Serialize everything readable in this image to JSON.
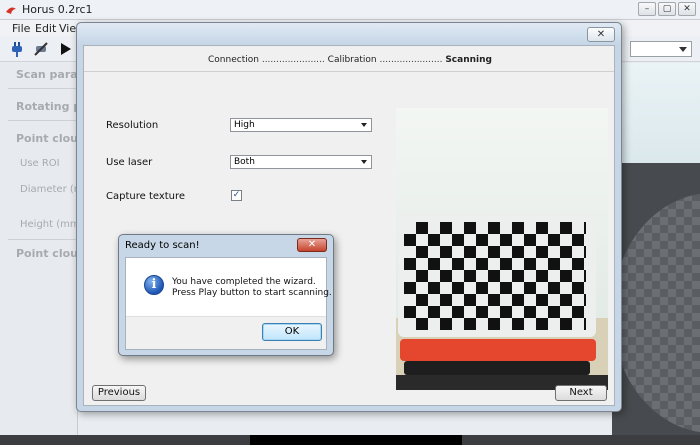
{
  "app": {
    "title": "Horus 0.2rc1",
    "menu": [
      "File",
      "Edit",
      "View"
    ],
    "window_controls": {
      "minimize": "–",
      "maximize": "▢",
      "close": "✕"
    },
    "toolbar": {
      "combo_value": ""
    }
  },
  "left_panel": {
    "headers": [
      "Scan parameters",
      "Rotating platform",
      "Point cloud ROI",
      "Point cloud color"
    ],
    "labels": [
      "Use ROI",
      "Diameter (mm)",
      "Height (mm)"
    ]
  },
  "wizard": {
    "close_label": "✕",
    "steps": [
      {
        "label": "Connection",
        "active": false
      },
      {
        "label": "Calibration",
        "active": false
      },
      {
        "label": "Scanning",
        "active": true
      }
    ],
    "step_separator": "......................",
    "form": {
      "resolution_label": "Resolution",
      "resolution_value": "High",
      "laser_label": "Use laser",
      "laser_value": "Both",
      "texture_label": "Capture texture",
      "texture_checked": "✓"
    },
    "previous_label": "Previous",
    "next_label": "Next"
  },
  "message_box": {
    "title": "Ready to scan!",
    "close_label": "✕",
    "icon_glyph": "i",
    "line1": "You have completed the wizard.",
    "line2": "Press Play button to start scanning.",
    "ok_label": "OK"
  },
  "colors": {
    "accent_red": "#e4462e",
    "title_blue": "#c6d6e6"
  }
}
